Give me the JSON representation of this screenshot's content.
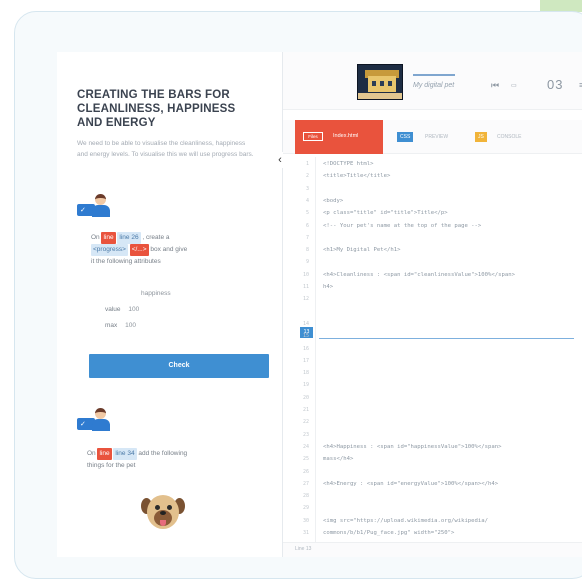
{
  "lesson": {
    "title": "CREATING THE BARS FOR CLEANLINESS, HAPPINESS AND ENERGY",
    "intro": "We need to be able to visualise the cleanliness, happiness and energy levels. To visualise this we will use progress bars.",
    "step1": {
      "prefix": "On",
      "tag_line": "line",
      "line_ref": "line 26",
      "middle": ", create a",
      "progress_tag": "<progress>",
      "after_progress": "",
      "close_tag": "</...>",
      "suffix": "box and give",
      "line2": "it the following attributes"
    },
    "attributes": [
      {
        "name": "",
        "value": "happiness"
      },
      {
        "name": "value",
        "value": "100"
      },
      {
        "name": "max",
        "value": "100"
      }
    ],
    "check_label": "Check",
    "step2": {
      "prefix": "On",
      "tag": "line",
      "line_ref": "line 34",
      "suffix": "add the following",
      "line2": "things for the pet"
    }
  },
  "player": {
    "track": "My digital pet",
    "counter": "03",
    "prev_icon": "skip-back-icon",
    "menu_icon": "menu-icon"
  },
  "toolbar": {
    "mini_label": "Files",
    "run_label": "Index.html",
    "tab1": "CSS",
    "text1": "PREVIEW",
    "tab2": "JS",
    "text2": "CONSOLE"
  },
  "code": {
    "lines": [
      {
        "n": "1",
        "text": "<!DOCTYPE html>"
      },
      {
        "n": "2",
        "text": "<title>Title</title>"
      },
      {
        "n": "3",
        "text": ""
      },
      {
        "n": "4",
        "text": "<body>"
      },
      {
        "n": "5",
        "text": "  <p class=\"title\" id=\"title\">Title</p>"
      },
      {
        "n": "6",
        "text": "  <!-- Your pet's name at the top of the page -->"
      },
      {
        "n": "7",
        "text": ""
      },
      {
        "n": "8",
        "text": "    <h1>My Digital Pet</h1>"
      },
      {
        "n": "9",
        "text": ""
      },
      {
        "n": "10",
        "text": "    <h4>Cleanliness : <span id=\"cleanlinessValue\">100%</span>"
      },
      {
        "n": "11",
        "text": "h4>"
      },
      {
        "n": "12",
        "text": ""
      },
      {
        "n": "13",
        "text": ""
      },
      {
        "n": "14",
        "text": ""
      },
      {
        "n": "15",
        "text": ""
      },
      {
        "n": "16",
        "text": ""
      },
      {
        "n": "17",
        "text": ""
      },
      {
        "n": "18",
        "text": ""
      },
      {
        "n": "19",
        "text": ""
      },
      {
        "n": "20",
        "text": ""
      },
      {
        "n": "21",
        "text": ""
      },
      {
        "n": "22",
        "text": ""
      },
      {
        "n": "23",
        "text": ""
      },
      {
        "n": "24",
        "text": "    <h4>Happiness : <span id=\"happinessValue\">100%</span>"
      },
      {
        "n": "25",
        "text": "mass</h4>"
      },
      {
        "n": "26",
        "text": ""
      },
      {
        "n": "27",
        "text": "    <h4>Energy : <span id=\"energyValue\">100%</span></h4>"
      },
      {
        "n": "28",
        "text": ""
      },
      {
        "n": "29",
        "text": ""
      },
      {
        "n": "30",
        "text": "    <img src=\"https://upload.wikimedia.org/wikipedia/"
      },
      {
        "n": "31",
        "text": "commons/b/b1/Pug_face.jpg\" width=\"250\">"
      }
    ],
    "active_line": "13"
  },
  "status": {
    "text": "Line 13"
  }
}
